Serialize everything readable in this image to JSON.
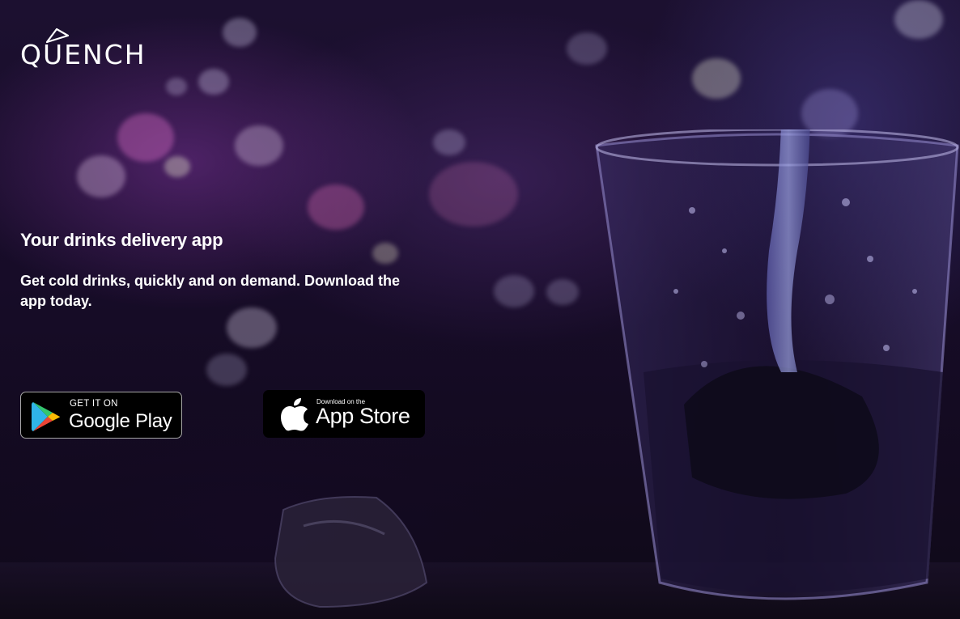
{
  "brand": {
    "logo_text": "QUENCH"
  },
  "hero": {
    "headline": "Your drinks delivery app",
    "subtext": "Get cold drinks, quickly and on demand. Download the app today."
  },
  "badges": {
    "google_play": {
      "small": "GET IT ON",
      "big": "Google Play",
      "icon": "google-play-icon"
    },
    "app_store": {
      "small": "Download on the",
      "big": "App Store",
      "icon": "apple-icon"
    }
  },
  "colors": {
    "background": "#170c28",
    "text": "#ffffff",
    "badge_bg": "#000000",
    "badge_border": "#a6a6a6"
  }
}
